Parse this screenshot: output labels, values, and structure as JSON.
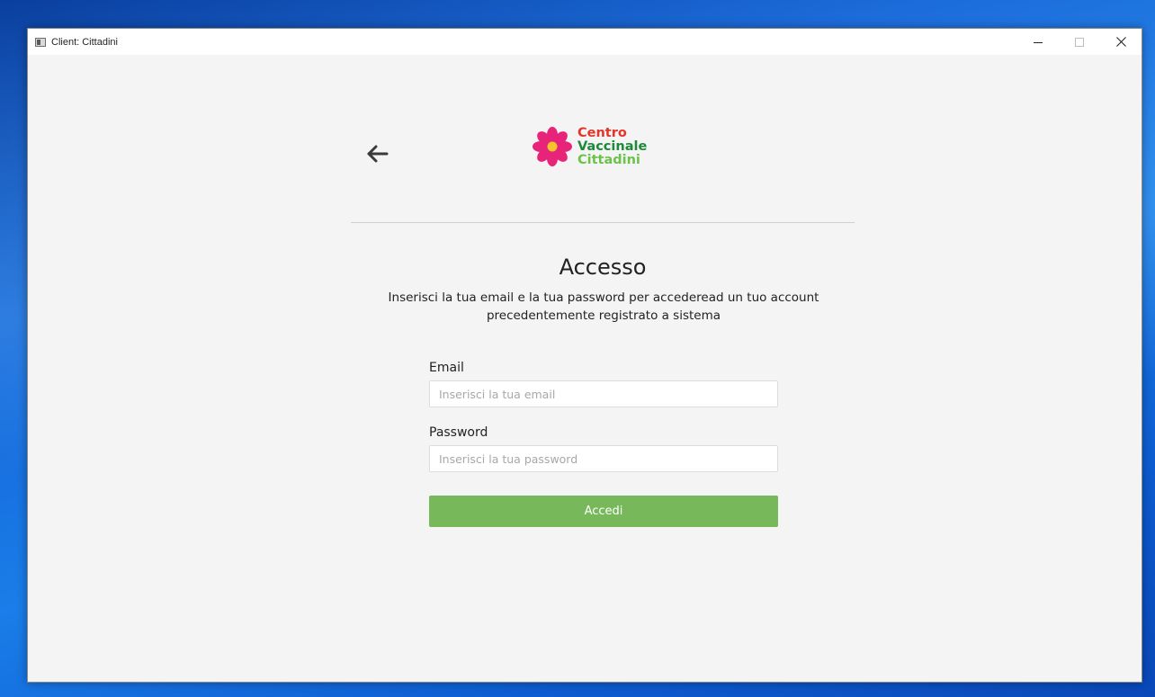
{
  "window": {
    "title": "Client: Cittadini",
    "controls": {
      "minimize": "minimize-icon",
      "maximize": "maximize-icon",
      "close": "close-icon"
    }
  },
  "header": {
    "back_icon": "arrow-left-icon",
    "logo": {
      "line1": "Centro",
      "line2": "Vaccinale",
      "line3": "Cittadini"
    }
  },
  "main": {
    "title": "Accesso",
    "subtitle": "Inserisci la tua email e la tua password per accederead un tuo account precedentemente registrato a sistema"
  },
  "form": {
    "email": {
      "label": "Email",
      "placeholder": "Inserisci la tua email",
      "value": ""
    },
    "password": {
      "label": "Password",
      "placeholder": "Inserisci la tua password",
      "value": ""
    },
    "submit_label": "Accedi"
  },
  "colors": {
    "accent_green": "#77b85a",
    "logo_red": "#e5352a",
    "logo_dark_green": "#1b8a3a",
    "logo_light_green": "#6cc24a",
    "flower_pink": "#e8237a",
    "flower_center": "#f7c52b"
  }
}
